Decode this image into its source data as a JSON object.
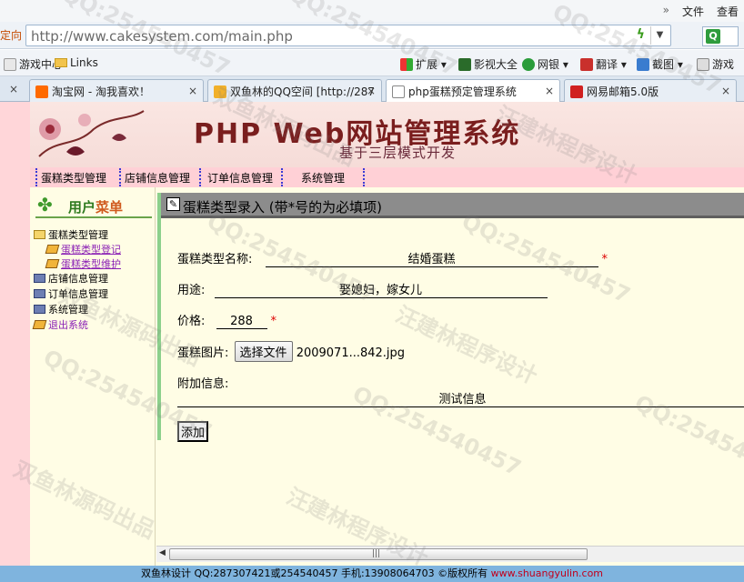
{
  "browser": {
    "menu_items": [
      "文件",
      "查看"
    ],
    "chevron": "»",
    "address_prefix": "定向",
    "url": "http://www.cakesystem.com/main.php",
    "bookmarks": [
      "游戏中心",
      "Links"
    ],
    "toolbar_buttons": [
      "扩展",
      "影视大全",
      "网银",
      "翻译",
      "截图",
      "游戏"
    ],
    "tabs": [
      {
        "title": "淘宝网 - 淘我喜欢！",
        "icon_color": "#ff6a00"
      },
      {
        "title": "双鱼林的QQ空间 [http://287",
        "icon_color": "#f1b02a"
      },
      {
        "title": "php蛋糕预定管理系统",
        "icon_color": "#ffffff"
      },
      {
        "title": "网易邮箱5.0版",
        "icon_color": "#d02020"
      }
    ]
  },
  "banner": {
    "title": "PHP Web网站管理系统",
    "subtitle": "基于三层模式开发"
  },
  "topnav": [
    "蛋糕类型管理",
    "店铺信息管理",
    "订单信息管理",
    "系统管理"
  ],
  "sidebar": {
    "title_green": "用户",
    "title_orange": "菜单",
    "items": [
      {
        "label": "蛋糕类型管理",
        "icon": "folder-icon"
      },
      {
        "label": "蛋糕类型登记",
        "icon": "document-icon"
      },
      {
        "label": "蛋糕类型维护",
        "icon": "document-icon"
      },
      {
        "label": "店铺信息管理",
        "icon": "monitor-icon"
      },
      {
        "label": "订单信息管理",
        "icon": "monitor-icon"
      },
      {
        "label": "系统管理",
        "icon": "monitor-icon"
      },
      {
        "label": "退出系统",
        "icon": "document-icon"
      }
    ]
  },
  "form": {
    "title": "蛋糕类型录入 (带*号的为必填项)",
    "type_name_label": "蛋糕类型名称:",
    "type_name_value": "结婚蛋糕",
    "required_mark": "*",
    "use_label": "用途:",
    "use_value": "娶媳妇，嫁女儿",
    "price_label": "价格:",
    "price_value": "288",
    "image_label": "蛋糕图片:",
    "file_button": "选择文件",
    "file_name": "2009071...842.jpg",
    "extra_label": "附加信息:",
    "extra_value": "测试信息",
    "submit": "添加"
  },
  "scroll_grip": "|||",
  "footer": {
    "text": "双鱼林设计 QQ:287307421或254540457 手机:13908064703 ©版权所有 ",
    "site": "www.shuangyulin.com"
  },
  "watermarks": [
    "QQ:254540457",
    "汪建林程序设计",
    "双鱼林源码出品"
  ],
  "colors": {
    "page_bg": "#ffd6d9",
    "content_bg": "#fffde5",
    "accent_green": "#8cd08c",
    "footer_bg": "#7fb4de",
    "link_purple": "#8a1fb5"
  }
}
